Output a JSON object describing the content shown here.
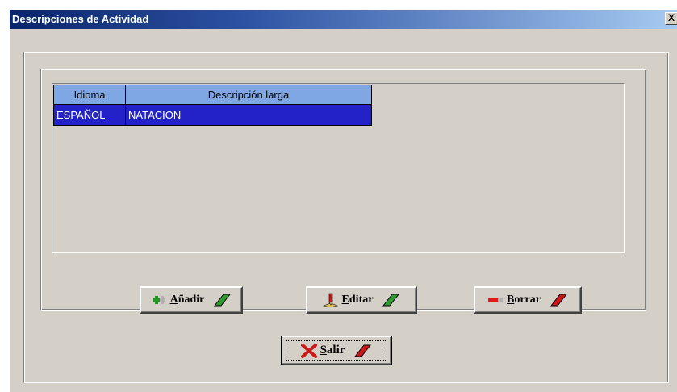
{
  "window": {
    "title": "Descripciones de Actividad",
    "close_glyph": "X"
  },
  "grid": {
    "columns": [
      "Idioma",
      "Descripción larga"
    ],
    "rows": [
      {
        "idioma": "ESPAÑOL",
        "descripcion": "NATACION"
      }
    ]
  },
  "buttons": {
    "anadir": {
      "prefix": "A",
      "rest": "ñadir",
      "icon": "green-plus-icon",
      "accent": "#2f9a2f"
    },
    "editar": {
      "prefix": "E",
      "rest": "ditar",
      "icon": "edit-pencil-icon",
      "accent": "#2f9a2f"
    },
    "borrar": {
      "prefix": "B",
      "rest": "orrar",
      "icon": "red-minus-icon",
      "accent": "#c81a1a"
    },
    "salir": {
      "prefix": "S",
      "rest": "alir",
      "icon": "red-x-icon",
      "accent": "#c81a1a"
    }
  },
  "colors": {
    "header_bg": "#7fa7e3",
    "selected_row_bg": "#2222c8",
    "dialog_bg": "#d4d0c8",
    "titlebar_start": "#0a246a",
    "titlebar_end": "#a6caf0"
  }
}
